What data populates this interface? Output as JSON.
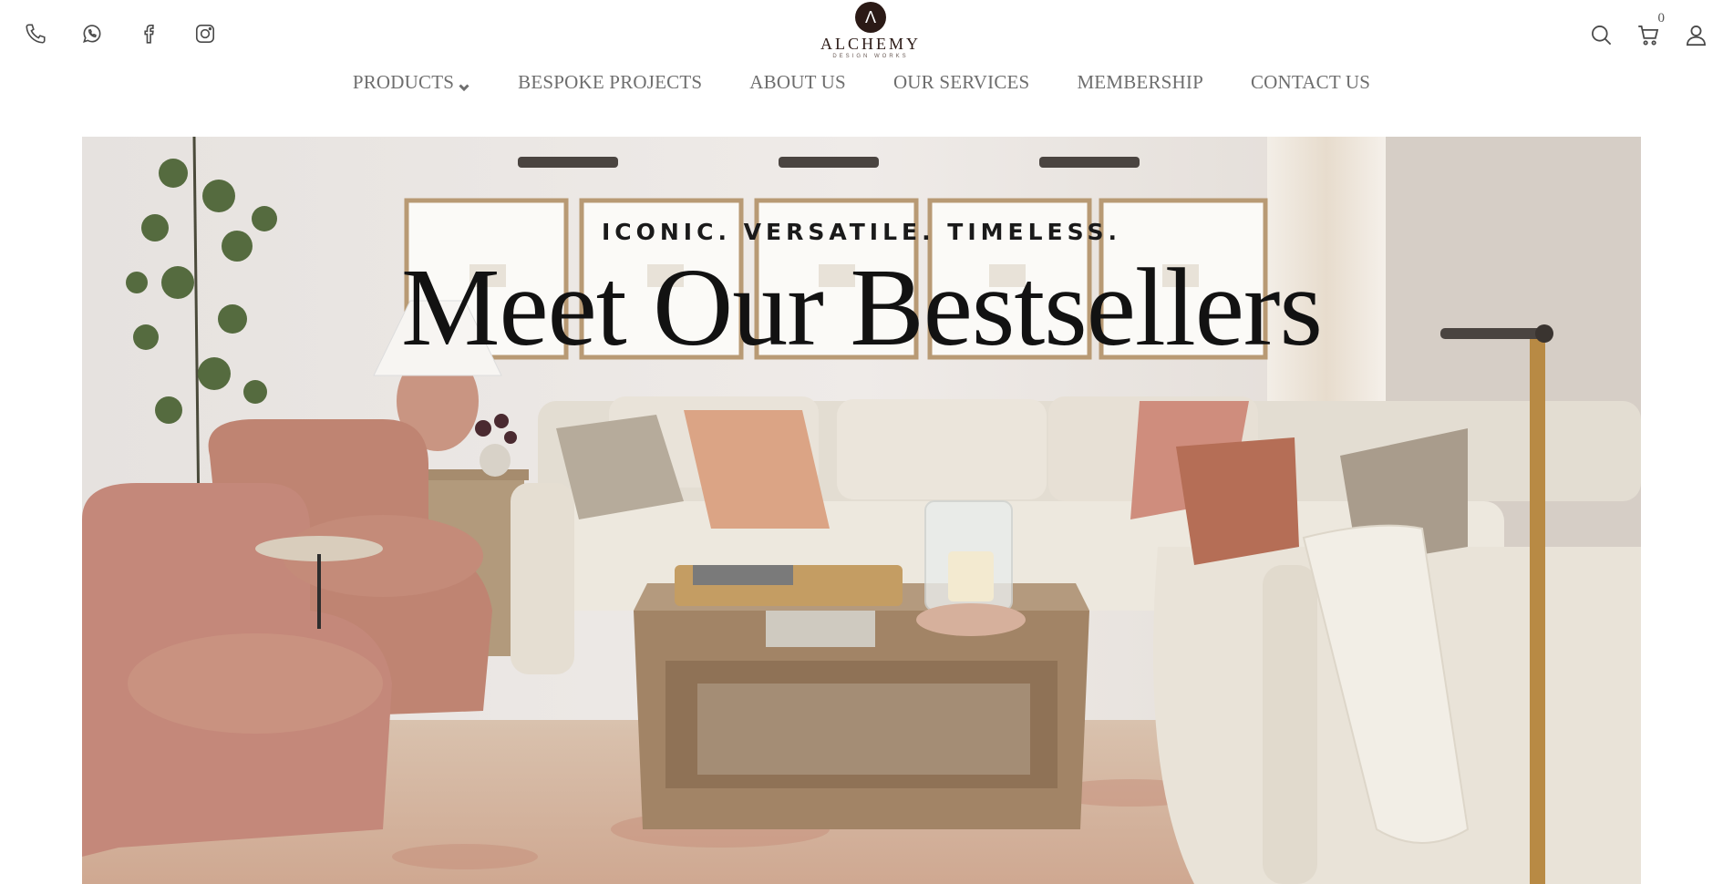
{
  "header": {
    "social_icons": [
      {
        "icon": "phone-icon",
        "label": "Phone"
      },
      {
        "icon": "whatsapp-icon",
        "label": "WhatsApp"
      },
      {
        "icon": "facebook-icon",
        "label": "Facebook"
      },
      {
        "icon": "instagram-icon",
        "label": "Instagram"
      }
    ],
    "logo": {
      "mark": "Λ",
      "name": "ALCHEMY",
      "subtitle": "DESIGN WORKS"
    },
    "utility_icons": [
      {
        "icon": "search-icon"
      },
      {
        "icon": "cart-icon"
      },
      {
        "icon": "user-icon"
      }
    ],
    "cart_count": "0"
  },
  "nav": {
    "items": [
      {
        "label": "PRODUCTS",
        "has_dropdown": true
      },
      {
        "label": "BESPOKE PROJECTS"
      },
      {
        "label": "ABOUT US"
      },
      {
        "label": "OUR SERVICES"
      },
      {
        "label": "MEMBERSHIP"
      },
      {
        "label": "CONTACT US"
      }
    ]
  },
  "hero": {
    "eyebrow": "ICONIC. VERSATILE. TIMELESS.",
    "title": "Meet Our Bestsellers"
  },
  "colors": {
    "logo_dark": "#2b1a16",
    "nav_text": "#6e6e6e",
    "icon_stroke": "#4a4a4a",
    "sofa": "#e7dfd2",
    "velvet_chair": "#c98f7b",
    "wood_table": "#a08468"
  }
}
